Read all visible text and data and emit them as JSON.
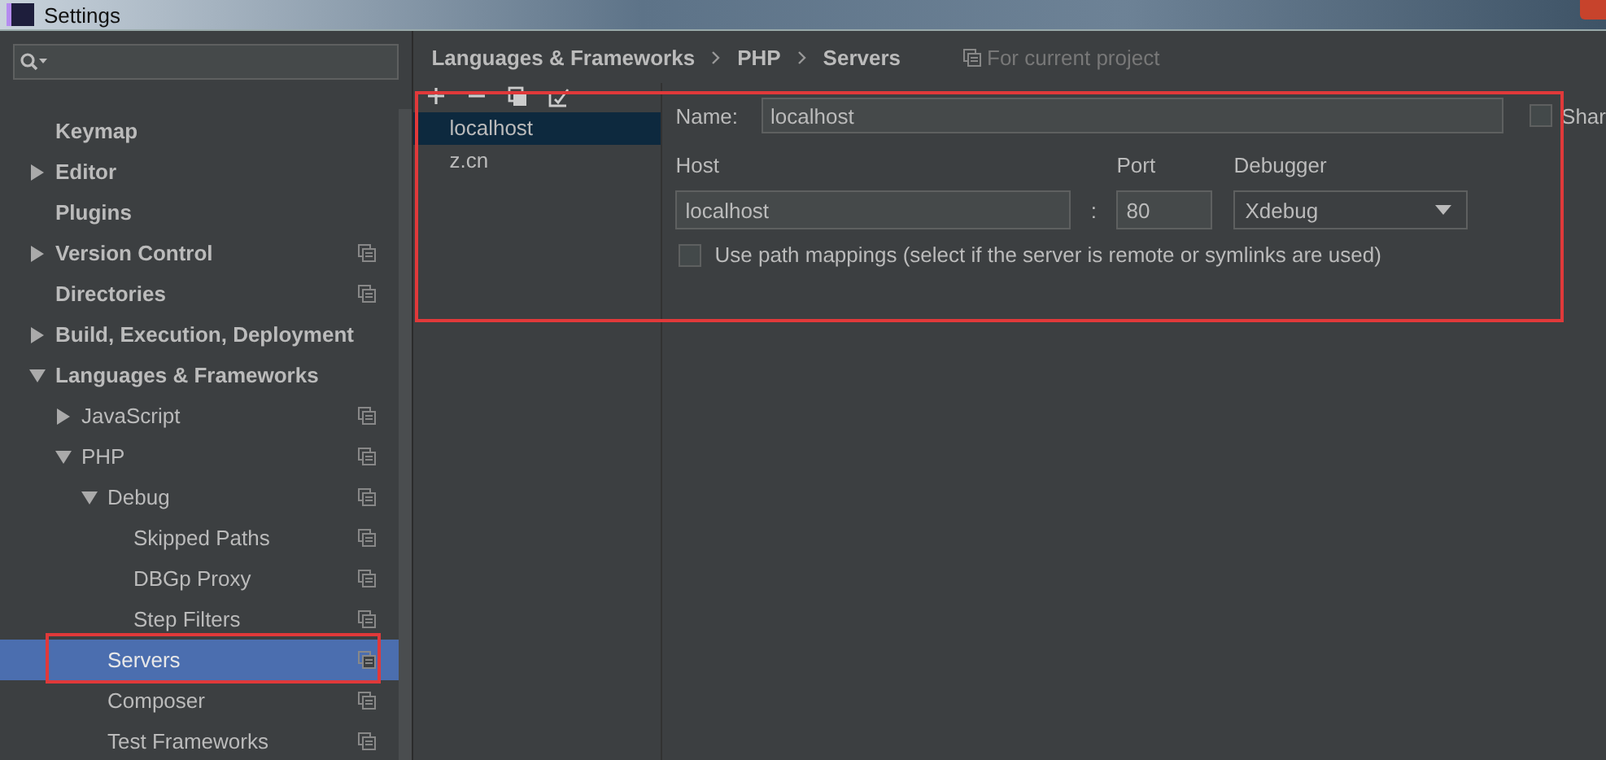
{
  "window": {
    "title": "Settings"
  },
  "sidebar": {
    "items": [
      {
        "label": "Keymap",
        "project_level": false,
        "selected": false,
        "highlighted": false
      },
      {
        "label": "Editor",
        "expanded": false,
        "project_level": false,
        "selected": false,
        "highlighted": false
      },
      {
        "label": "Plugins",
        "project_level": false,
        "selected": false,
        "highlighted": false
      },
      {
        "label": "Version Control",
        "expanded": false,
        "project_level": true,
        "selected": false,
        "highlighted": false
      },
      {
        "label": "Directories",
        "project_level": true,
        "selected": false,
        "highlighted": false
      },
      {
        "label": "Build, Execution, Deployment",
        "expanded": false,
        "project_level": false,
        "selected": false,
        "highlighted": false
      },
      {
        "label": "Languages & Frameworks",
        "expanded": true,
        "project_level": false,
        "selected": false,
        "highlighted": false,
        "children": [
          {
            "label": "JavaScript",
            "expanded": false,
            "project_level": true,
            "selected": false,
            "highlighted": false
          },
          {
            "label": "PHP",
            "expanded": true,
            "project_level": true,
            "selected": false,
            "highlighted": false,
            "children": [
              {
                "label": "Debug",
                "expanded": true,
                "project_level": true,
                "selected": false,
                "highlighted": false,
                "children": [
                  {
                    "label": "Skipped Paths",
                    "project_level": true,
                    "selected": false,
                    "highlighted": false
                  },
                  {
                    "label": "DBGp Proxy",
                    "project_level": true,
                    "selected": false,
                    "highlighted": false
                  },
                  {
                    "label": "Step Filters",
                    "project_level": true,
                    "selected": false,
                    "highlighted": false
                  }
                ]
              },
              {
                "label": "Servers",
                "project_level": true,
                "selected": true,
                "highlighted": true
              },
              {
                "label": "Composer",
                "project_level": true,
                "selected": false,
                "highlighted": false
              },
              {
                "label": "Test Frameworks",
                "project_level": true,
                "selected": false,
                "highlighted": false
              }
            ]
          }
        ]
      }
    ]
  },
  "breadcrumb": [
    "Languages & Frameworks",
    "PHP",
    "Servers"
  ],
  "scope_note": "For current project",
  "servers_panel": {
    "highlighted": true,
    "servers": [
      {
        "name": "localhost",
        "selected": true
      },
      {
        "name": "z.cn",
        "selected": false
      }
    ],
    "name_label": "Name:",
    "name_value": "localhost",
    "share": {
      "label": "Shar",
      "checked": false
    },
    "host_label": "Host",
    "host_value": "localhost",
    "separator": ":",
    "port_label": "Port",
    "port_value": "80",
    "debugger_label": "Debugger",
    "debugger_value": "Xdebug",
    "path_mappings": {
      "label": "Use path mappings (select if the server is remote or symlinks are used)",
      "checked": false
    }
  }
}
